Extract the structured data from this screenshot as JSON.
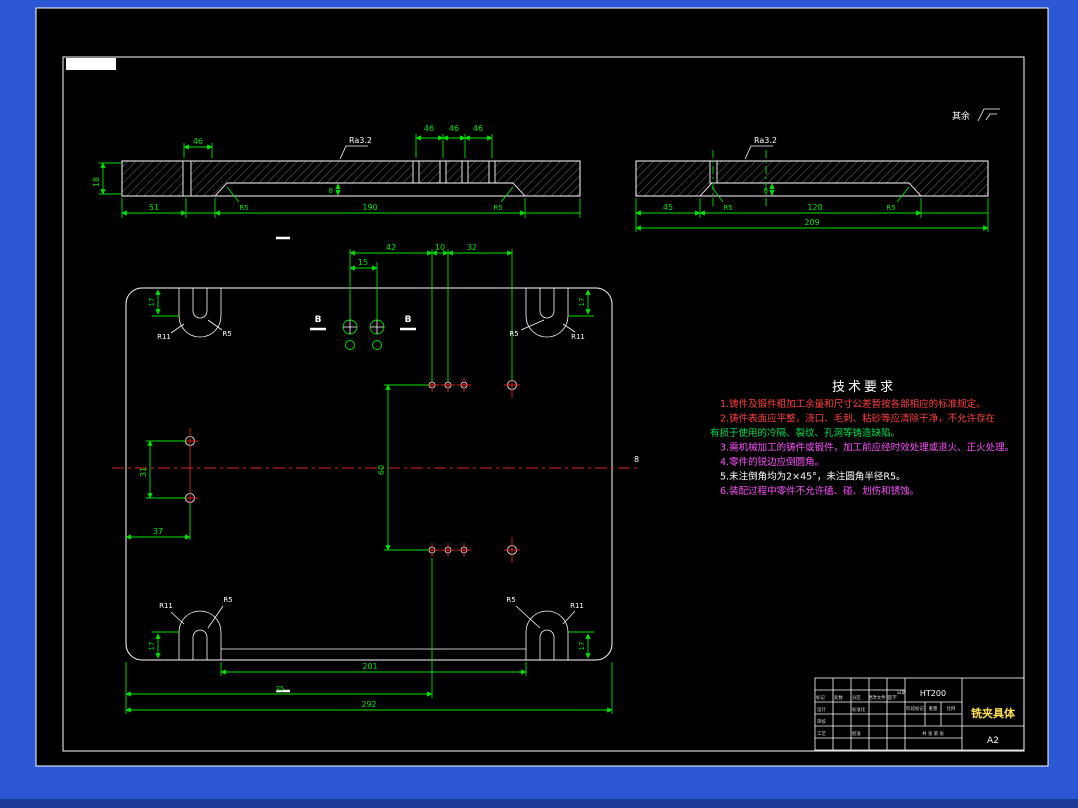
{
  "colors": {
    "background": "#2b57d5",
    "canvas": "#000000",
    "outline": "#ffffff",
    "dimension": "#00e400",
    "centerline": "#e02020",
    "part_name_accent": "#ffe14d"
  },
  "surface_note": {
    "label": "其余"
  },
  "section_left": {
    "ra_label": "Ra3.2",
    "dims_46": [
      "46",
      "46",
      "46",
      "46"
    ],
    "dim_inner": "8",
    "dim_51": "51",
    "dim_190": "190",
    "fillet": "R5",
    "dim_height": "18"
  },
  "section_right": {
    "ra_label": "Ra3.2",
    "dim_inner": "8",
    "dim_45": "45",
    "dim_120": "120",
    "fillet": "R5",
    "dim_total": "209"
  },
  "plan_view": {
    "dim_42": "42",
    "dim_10": "10",
    "dim_32": "32",
    "dim_15": "15",
    "dim_60": "60",
    "dim_31": "31",
    "dim_37": "37",
    "dim_17": "17",
    "dim_201": "201",
    "dim_mid": "25",
    "dim_292": "292",
    "hole_label": "8",
    "section_letter": "B",
    "r11": "R11",
    "r5": "R5"
  },
  "tech_requirements": {
    "title": "技术要求",
    "lines": [
      {
        "text": "1.铸件及锻件粗加工余量和尺寸公差暂按各部相应的标准规定。",
        "color": "#ff4040"
      },
      {
        "text": "2.铸件表面应平整，浇口、毛刺、粘砂等应清除干净，不允许存在",
        "color": "#ff4040"
      },
      {
        "text": "有损于使用的冷隔、裂纹、孔洞等铸造缺陷。",
        "color": "#00e050"
      },
      {
        "text": "3.需机械加工的铸件或锻件，加工前应经时效处理或退火、正火处理。",
        "color": "#ff50ff"
      },
      {
        "text": "4.零件的锐边应倒圆角。",
        "color": "#ff50ff"
      },
      {
        "text": "5.未注倒角均为2×45°，未注圆角半径R5。",
        "color": "#ffffff"
      },
      {
        "text": "6.装配过程中零件不允许磕、碰、划伤和锈蚀。",
        "color": "#ff50ff"
      }
    ]
  },
  "title_block": {
    "material": "HT200",
    "part_name": "铣夹具体",
    "sheet": "A2",
    "labels": {
      "mark": "标记",
      "qty": "处数",
      "zone": "分区",
      "doc": "更改文件号",
      "sign": "签字",
      "date": "日期",
      "design": "设计",
      "standard": "标准化",
      "check": "审核",
      "craft": "工艺",
      "approve": "批准",
      "stage": "阶段标记",
      "weight": "重量",
      "scale": "比例",
      "sheets": "共 张 第 张"
    }
  }
}
